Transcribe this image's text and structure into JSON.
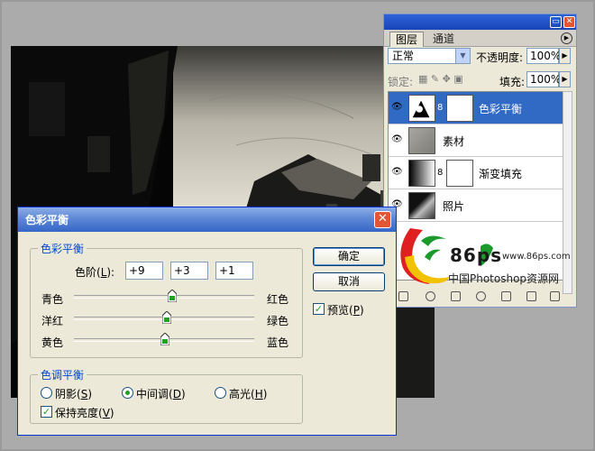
{
  "layers_panel": {
    "tabs": [
      "图层",
      "通道"
    ],
    "blend_mode": "正常",
    "opacity_label": "不透明度:",
    "opacity_value": "100%",
    "lock_label": "锁定:",
    "fill_label": "填充:",
    "fill_value": "100%",
    "layers": [
      {
        "name": "色彩平衡",
        "selected": true
      },
      {
        "name": "素材",
        "selected": false
      },
      {
        "name": "渐变填充",
        "selected": false
      },
      {
        "name": "照片",
        "selected": false
      }
    ]
  },
  "watermark": {
    "brand": "86ps",
    "url": "www.86ps.com",
    "tagline": "中国Photoshop资源网"
  },
  "dialog": {
    "title": "色彩平衡",
    "close_icon": "close-icon",
    "color_balance_group": "色彩平衡",
    "levels_label": "色阶(",
    "levels_key": "L",
    "levels_suffix": "):",
    "levels_values": [
      "+9",
      "+3",
      "+1"
    ],
    "sliders": [
      {
        "left": "青色",
        "right": "红色",
        "value": 9
      },
      {
        "left": "洋红",
        "right": "绿色",
        "value": 3
      },
      {
        "left": "黄色",
        "right": "蓝色",
        "value": 1
      }
    ],
    "tone_group": "色调平衡",
    "tones": [
      {
        "label": "阴影(",
        "key": "S",
        "suffix": ")",
        "checked": false
      },
      {
        "label": "中间调(",
        "key": "D",
        "suffix": ")",
        "checked": true
      },
      {
        "label": "高光(",
        "key": "H",
        "suffix": ")",
        "checked": false
      }
    ],
    "preserve_label": "保持亮度(",
    "preserve_key": "V",
    "preserve_suffix": ")",
    "preserve_checked": true,
    "ok_label": "确定",
    "cancel_label": "取消",
    "preview_label": "预览(",
    "preview_key": "P",
    "preview_suffix": ")",
    "preview_checked": true
  }
}
